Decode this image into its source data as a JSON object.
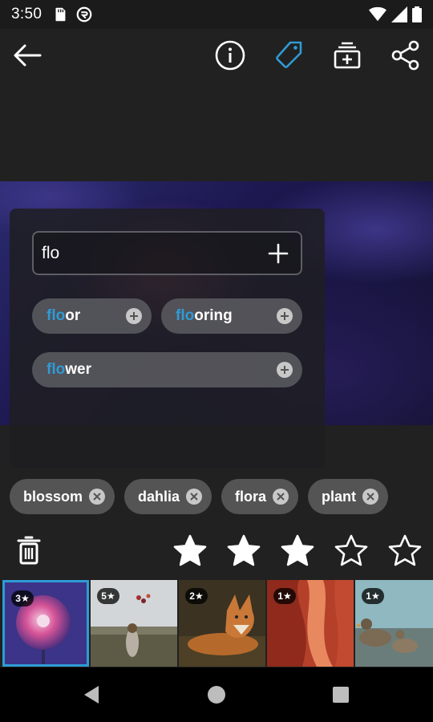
{
  "status_bar": {
    "time": "3:50",
    "left_icons": [
      "sd-card-icon",
      "at-sign-icon"
    ],
    "right_icons": [
      "wifi-icon",
      "cell-signal-icon",
      "battery-icon"
    ]
  },
  "toolbar": {
    "icons": [
      "back-arrow-icon",
      "info-icon",
      "tag-icon",
      "add-to-collection-icon",
      "share-icon"
    ],
    "active_icon": "tag-icon",
    "accent_color": "#2f9bd4"
  },
  "tag_editor": {
    "input_value": "flo",
    "suggestions": [
      {
        "match": "flo",
        "rest": "or"
      },
      {
        "match": "flo",
        "rest": "oring"
      },
      {
        "match": "flo",
        "rest": "wer"
      }
    ]
  },
  "applied_tags": [
    {
      "label": "blossom"
    },
    {
      "label": "dahlia"
    },
    {
      "label": "flora"
    },
    {
      "label": "plant"
    }
  ],
  "rating": {
    "value": 3,
    "max": 5
  },
  "filmstrip": [
    {
      "badge": "3★",
      "subject": "pink dahlia",
      "selected": true
    },
    {
      "badge": "5★",
      "subject": "girl with balloons in field",
      "selected": false
    },
    {
      "badge": "2★",
      "subject": "fox lying",
      "selected": false
    },
    {
      "badge": "1★",
      "subject": "red canyon",
      "selected": false
    },
    {
      "badge": "1★",
      "subject": "ducks by water",
      "selected": false
    }
  ],
  "navbar": {
    "icons": [
      "back-triangle-icon",
      "home-circle-icon",
      "recents-square-icon"
    ]
  }
}
